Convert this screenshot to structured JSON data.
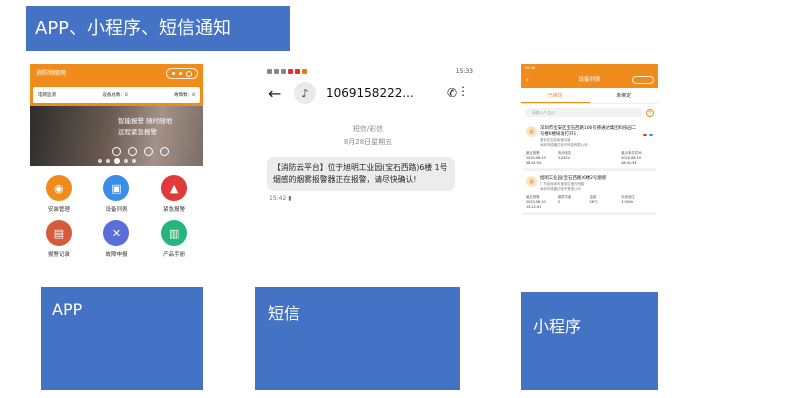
{
  "slide_title": "APP、小程序、短信通知",
  "app": {
    "header_title": "消防物联网",
    "stats": [
      "电网监测",
      "设备总数：0",
      "故障数：0"
    ],
    "banner_line1": "智能报警  随时随地",
    "banner_line2": "远程紧急报警",
    "grid": [
      {
        "label": "安装管理",
        "color": "#f08c1c",
        "icon": "map-pin-icon",
        "glyph": "◉"
      },
      {
        "label": "设备列表",
        "color": "#3a8ee6",
        "icon": "device-icon",
        "glyph": "▣"
      },
      {
        "label": "紧急报警",
        "color": "#e03a3a",
        "icon": "alarm-icon",
        "glyph": "▲"
      },
      {
        "label": "报警记录",
        "color": "#d65b3c",
        "icon": "record-icon",
        "glyph": "▤"
      },
      {
        "label": "故障申报",
        "color": "#5a6fd8",
        "icon": "tools-icon",
        "glyph": "✕"
      },
      {
        "label": "产品手册",
        "color": "#26b57a",
        "icon": "manual-icon",
        "glyph": "▥"
      }
    ]
  },
  "sms": {
    "status_time": "15:33",
    "number": "1069158222...",
    "type_label": "短信/彩信",
    "date_label": "8月28日星期五",
    "message": "【消防云平台】位于旭明工业园(宝石西路)6楼 1号烟感的烟雾报警器正在报警，请尽快确认!",
    "time": "15:42"
  },
  "mini": {
    "status_text": "09:46",
    "title": "设备列表",
    "tab_bound": "已绑定",
    "tab_unbound": "未绑定",
    "search_placeholder": "请输入产品ID",
    "cards": [
      {
        "icon": "烟",
        "title": "深圳市宝安区宝石西路106号德通达集团科技园二号楼6楼研发打开1",
        "addr1": "宝安区石岩街道中新",
        "addr2": "深圳市德通达电子科技有限公司",
        "data": [
          [
            "最近报警",
            "2020-08-19 08:41:54"
          ],
          [
            "电池电压",
            "3.032V"
          ],
          [
            "",
            ""
          ],
          [
            "最近事件时间",
            "2020-08-19 08:41:54"
          ]
        ]
      },
      {
        "icon": "烟",
        "title": "旭明工业园(宝石西路)6楼2号烟感",
        "addr1": "广东省深圳市宝安区宝石西路",
        "addr2": "深圳市德通达电子有限公司",
        "data": [
          [
            "最近报警",
            "2020-06-10 14:22:41"
          ],
          [
            "烟雾浓度",
            "0"
          ],
          [
            "温度",
            "28°C"
          ],
          [
            "电池电压",
            "3.004V"
          ]
        ]
      }
    ]
  },
  "labels": {
    "app": "APP",
    "sms": "短信",
    "mini": "小程序"
  }
}
